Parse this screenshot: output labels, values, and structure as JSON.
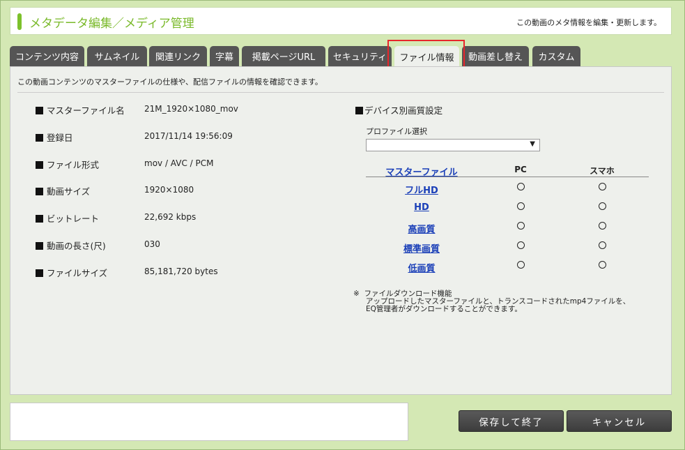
{
  "header": {
    "title": "メタデータ編集／メディア管理",
    "description": "この動画のメタ情報を編集・更新します。"
  },
  "tabs": [
    {
      "label": "コンテンツ内容"
    },
    {
      "label": "サムネイル"
    },
    {
      "label": "関連リンク"
    },
    {
      "label": "字幕"
    },
    {
      "label": "掲載ページURL"
    },
    {
      "label": "セキュリティ"
    },
    {
      "label": "ファイル情報",
      "active": true
    },
    {
      "label": "動画差し替え"
    },
    {
      "label": "カスタム"
    }
  ],
  "panel": {
    "intro": "この動画コンテンツのマスターファイルの仕様や、配信ファイルの情報を確認できます。"
  },
  "file_info": [
    {
      "label": "マスターファイル名",
      "value": "21M_1920×1080_mov"
    },
    {
      "label": "登録日",
      "value": "2017/11/14 19:56:09"
    },
    {
      "label": "ファイル形式",
      "value": "mov / AVC / PCM"
    },
    {
      "label": "動画サイズ",
      "value": "1920×1080"
    },
    {
      "label": "ビットレート",
      "value": "22,692 kbps"
    },
    {
      "label": "動画の長さ(尺)",
      "value": "030"
    },
    {
      "label": "ファイルサイズ",
      "value": "85,181,720 bytes"
    }
  ],
  "device": {
    "title": "デバイス別画質設定",
    "profile_label": "プロファイル選択",
    "profile_value": "",
    "columns": {
      "master": "マスターファイル",
      "pc": "PC",
      "smartphone": "スマホ"
    },
    "rows": [
      {
        "label": "フルHD"
      },
      {
        "label": "HD"
      },
      {
        "label": "高画質"
      },
      {
        "label": "標準画質"
      },
      {
        "label": "低画質"
      }
    ]
  },
  "note": {
    "mark": "※",
    "title": "ファイルダウンロード機能",
    "line1": "アップロードしたマスターファイルと、トランスコードされたmp4ファイルを、",
    "line2": "EQ管理者がダウンロードすることができます。"
  },
  "buttons": {
    "save": "保存して終了",
    "cancel": "キャンセル"
  },
  "colors": {
    "background": "#d4e8b4",
    "accent_green": "#7cc12b",
    "tab_dark": "#555555",
    "highlight_red": "#e8262a",
    "link_blue": "#1a3fb8"
  }
}
